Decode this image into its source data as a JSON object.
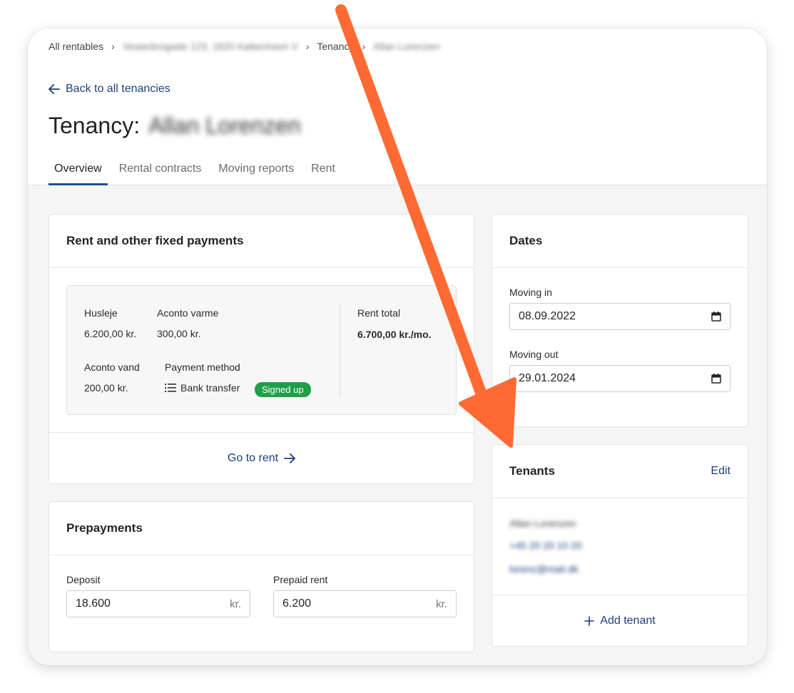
{
  "breadcrumb": {
    "root": "All rentables",
    "property": "Vesterbrogade 123, 1620 København V",
    "section": "Tenancy",
    "tenant": "Allan Lorenzen"
  },
  "back_link": "Back to all tenancies",
  "title": {
    "prefix": "Tenancy:",
    "name": "Allan Lorenzen"
  },
  "tabs": [
    {
      "label": "Overview",
      "active": true
    },
    {
      "label": "Rental contracts",
      "active": false
    },
    {
      "label": "Moving reports",
      "active": false
    },
    {
      "label": "Rent",
      "active": false
    }
  ],
  "rent_card": {
    "title": "Rent and other fixed payments",
    "husleje_label": "Husleje",
    "husleje_value": "6.200,00 kr.",
    "aconto_varme_label": "Aconto varme",
    "aconto_varme_value": "300,00 kr.",
    "aconto_vand_label": "Aconto vand",
    "aconto_vand_value": "200,00 kr.",
    "payment_method_label": "Payment method",
    "payment_method_value": "Bank transfer",
    "payment_status": "Signed up",
    "rent_total_label": "Rent total",
    "rent_total_value": "6.700,00 kr./mo.",
    "go_to_rent": "Go to rent"
  },
  "prepayments": {
    "title": "Prepayments",
    "deposit_label": "Deposit",
    "deposit_value": "18.600",
    "prepaid_rent_label": "Prepaid rent",
    "prepaid_rent_value": "6.200",
    "currency": "kr."
  },
  "dates": {
    "title": "Dates",
    "moving_in_label": "Moving in",
    "moving_in_value": "08.09.2022",
    "moving_out_label": "Moving out",
    "moving_out_value": "29.01.2024"
  },
  "tenants": {
    "title": "Tenants",
    "edit": "Edit",
    "name": "Allan Lorenzen",
    "phone": "+45 20 20 10 20",
    "email": "lorenz@mail.dk",
    "add_tenant": "Add tenant"
  },
  "colors": {
    "accent": "#1c3f7a",
    "tab_underline": "#1c4f9c",
    "badge": "#1f9f48",
    "arrow": "#ff6a33"
  }
}
